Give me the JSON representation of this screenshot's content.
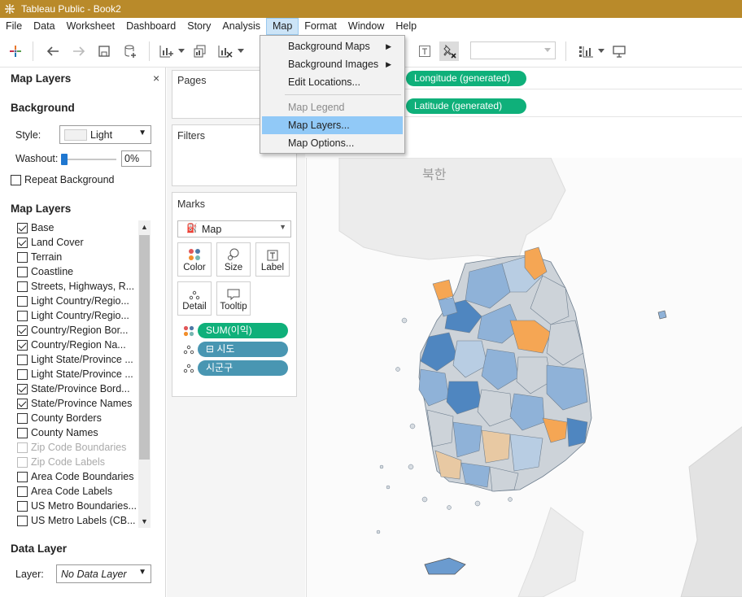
{
  "window": {
    "title": "Tableau Public - Book2"
  },
  "menubar": {
    "items": [
      "File",
      "Data",
      "Worksheet",
      "Dashboard",
      "Story",
      "Analysis",
      "Map",
      "Format",
      "Window",
      "Help"
    ],
    "active": "Map"
  },
  "map_menu": {
    "background_maps": "Background Maps",
    "background_images": "Background Images",
    "edit_locations": "Edit Locations...",
    "map_legend": "Map Legend",
    "map_layers": "Map Layers...",
    "map_options": "Map Options..."
  },
  "map_layers_panel": {
    "title": "Map Layers",
    "close": "×",
    "background_heading": "Background",
    "style_label": "Style:",
    "style_value": "Light",
    "washout_label": "Washout:",
    "washout_value": "0%",
    "washout_level": 0,
    "repeat_background": "Repeat Background",
    "layers_heading": "Map Layers",
    "layers": [
      {
        "label": "Base",
        "checked": true,
        "enabled": true
      },
      {
        "label": "Land Cover",
        "checked": true,
        "enabled": true
      },
      {
        "label": "Terrain",
        "checked": false,
        "enabled": true
      },
      {
        "label": "Coastline",
        "checked": false,
        "enabled": true
      },
      {
        "label": "Streets, Highways, R...",
        "checked": false,
        "enabled": true
      },
      {
        "label": "Light Country/Regio...",
        "checked": false,
        "enabled": true
      },
      {
        "label": "Light Country/Regio...",
        "checked": false,
        "enabled": true
      },
      {
        "label": "Country/Region Bor...",
        "checked": true,
        "enabled": true
      },
      {
        "label": "Country/Region Na...",
        "checked": true,
        "enabled": true
      },
      {
        "label": "Light State/Province ...",
        "checked": false,
        "enabled": true
      },
      {
        "label": "Light State/Province ...",
        "checked": false,
        "enabled": true
      },
      {
        "label": "State/Province Bord...",
        "checked": true,
        "enabled": true
      },
      {
        "label": "State/Province Names",
        "checked": true,
        "enabled": true
      },
      {
        "label": "County Borders",
        "checked": false,
        "enabled": true
      },
      {
        "label": "County Names",
        "checked": false,
        "enabled": true
      },
      {
        "label": "Zip Code Boundaries",
        "checked": false,
        "enabled": false
      },
      {
        "label": "Zip Code Labels",
        "checked": false,
        "enabled": false
      },
      {
        "label": "Area Code Boundaries",
        "checked": false,
        "enabled": true
      },
      {
        "label": "Area Code Labels",
        "checked": false,
        "enabled": true
      },
      {
        "label": "US Metro Boundaries...",
        "checked": false,
        "enabled": true
      },
      {
        "label": "US Metro Labels (CB...",
        "checked": false,
        "enabled": true
      }
    ],
    "data_layer_heading": "Data Layer",
    "layer_label": "Layer:",
    "layer_value": "No Data Layer"
  },
  "cards": {
    "pages": "Pages",
    "filters": "Filters",
    "marks": "Marks",
    "mark_type": "Map",
    "mark_buttons": [
      "Color",
      "Size",
      "Label",
      "Detail",
      "Tooltip"
    ],
    "mark_fields": [
      "SUM(이익)",
      "⊟ 시도",
      "시군구"
    ]
  },
  "shelves": {
    "columns": "Longitude (generated)",
    "rows": "Latitude (generated)"
  },
  "map": {
    "country_label": "북한",
    "colors": {
      "dark_blue": "#4f86c0",
      "mid_blue": "#8fb2d8",
      "light_blue": "#b8cde3",
      "grey": "#cdd3d9",
      "orange": "#f5a654",
      "tan": "#e8c9a3"
    }
  }
}
